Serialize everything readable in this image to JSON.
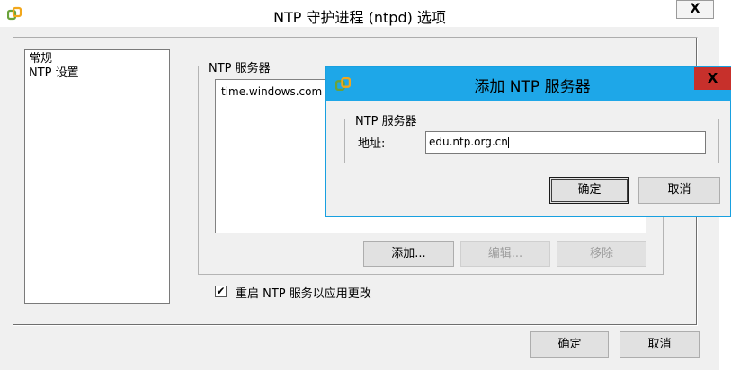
{
  "main_window": {
    "title": "NTP 守护进程 (ntpd) 选项",
    "close_label": "X",
    "nav_items": [
      {
        "label": "常规"
      },
      {
        "label": "NTP 设置"
      }
    ],
    "server_group_label": "NTP 服务器",
    "servers": [
      "time.windows.com"
    ],
    "add_label": "添加...",
    "edit_label": "编辑...",
    "remove_label": "移除",
    "restart_checkbox": {
      "checked": true,
      "mark": "✔",
      "label": "重启 NTP 服务以应用更改"
    },
    "ok_label": "确定",
    "cancel_label": "取消"
  },
  "add_dialog": {
    "title": "添加 NTP 服务器",
    "close_label": "X",
    "group_label": "NTP 服务器",
    "address_label": "地址:",
    "address_value": "edu.ntp.org.cn",
    "ok_label": "确定",
    "cancel_label": "取消"
  },
  "colors": {
    "dialog_titlebar": "#1ea7e8",
    "dialog_close": "#c7302b",
    "window_bg": "#f0f0f0"
  },
  "icons": {
    "app": "vmware-link-icon"
  }
}
